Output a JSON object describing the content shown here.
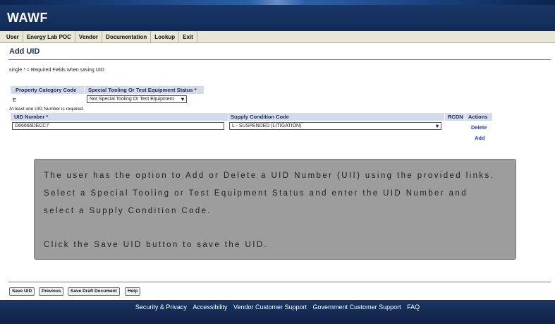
{
  "app": {
    "title": "WAWF"
  },
  "menu": [
    {
      "label": "User"
    },
    {
      "label": "Energy Lab POC"
    },
    {
      "label": "Vendor"
    },
    {
      "label": "Documentation"
    },
    {
      "label": "Lookup"
    },
    {
      "label": "Exit"
    }
  ],
  "page": {
    "title": "Add UID",
    "required_note": "single * = Required Fields when saving UID"
  },
  "property": {
    "col1_header": "Property Category Code",
    "col2_header": "Special Tooling Or Test Equipment Status *",
    "category_value": "E",
    "status_selected": "Not Special Tooling Or Test Equipment"
  },
  "uid": {
    "hint": "At least one UID Number is required.",
    "headers": {
      "uid_number": "UID Number *",
      "supply_condition": "Supply Condition Code",
      "rcdn": "RCDN",
      "actions": "Actions"
    },
    "row": {
      "uid_value": "D66666DECC7",
      "supply_condition_selected": "L - SUSPENDED (LITIGATION)",
      "delete_label": "Delete"
    },
    "add_label": "Add"
  },
  "overlay": {
    "line1": "The user has the option to Add or Delete a UID Number (UII) using the provided links.",
    "line2": "Select a Special Tooling or Test Equipment Status and enter the UID Number and",
    "line3": "select a Supply Condition Code.",
    "line4": "Click the Save UID button to save the UID."
  },
  "buttons": {
    "save_uid": "Save UID",
    "previous": "Previous",
    "save_draft": "Save Draft Document",
    "help": "Help"
  },
  "footer": {
    "links": [
      "Security & Privacy",
      "Accessibility",
      "Vendor Customer Support",
      "Government Customer Support",
      "FAQ"
    ]
  },
  "icons": {
    "select_chevron": "chevron-down-icon"
  },
  "colors": {
    "header_navy": "#0f2a55",
    "link_blue": "#1f3fd4",
    "table_header": "#d4dcec",
    "overlay_gray": "#9d9d9d"
  }
}
